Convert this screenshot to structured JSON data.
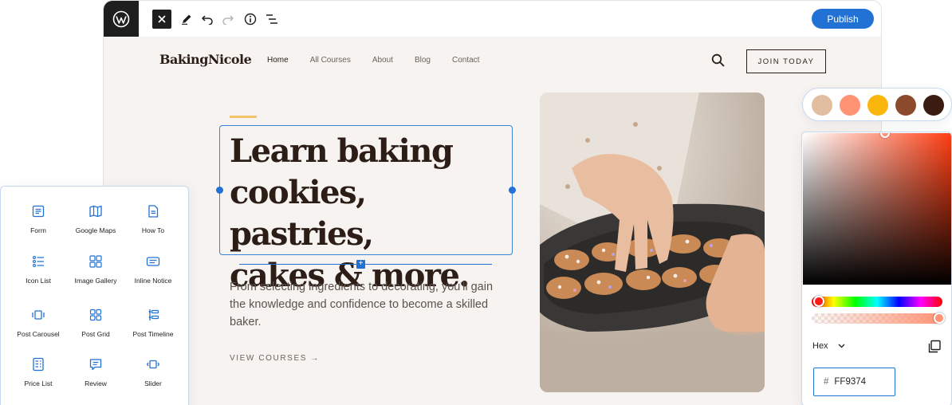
{
  "toolbar": {
    "publish_label": "Publish",
    "icons": [
      "wordpress-logo",
      "close-icon",
      "pencil-icon",
      "undo-icon",
      "redo-icon",
      "info-icon",
      "list-view-icon"
    ]
  },
  "site": {
    "logo": "BakingNicole",
    "nav": [
      "Home",
      "All Courses",
      "About",
      "Blog",
      "Contact"
    ],
    "active_nav": "Home",
    "join_label": "JOIN TODAY"
  },
  "hero": {
    "headline_lines": [
      "Learn baking",
      "cookies, pastries,",
      "cakes & more."
    ],
    "paragraph": "From selecting ingredients to decorating, you'll gain the knowledge and confidence to become a skilled baker.",
    "cta": "VIEW COURSES →"
  },
  "blocks": [
    {
      "label": "Form",
      "icon": "form-icon"
    },
    {
      "label": "Google Maps",
      "icon": "map-icon"
    },
    {
      "label": "How To",
      "icon": "document-icon"
    },
    {
      "label": "Icon List",
      "icon": "icon-list-icon"
    },
    {
      "label": "Image Gallery",
      "icon": "gallery-icon"
    },
    {
      "label": "Inline Notice",
      "icon": "notice-icon"
    },
    {
      "label": "Post Carousel",
      "icon": "carousel-icon"
    },
    {
      "label": "Post Grid",
      "icon": "grid-icon"
    },
    {
      "label": "Post Timeline",
      "icon": "timeline-icon"
    },
    {
      "label": "Price List",
      "icon": "price-list-icon"
    },
    {
      "label": "Review",
      "icon": "review-icon"
    },
    {
      "label": "Slider",
      "icon": "slider-icon"
    }
  ],
  "palette": [
    "#E2BEA0",
    "#FF9374",
    "#FBB60E",
    "#8B4A2B",
    "#3A1C12"
  ],
  "picker": {
    "format": "Hex",
    "hash": "#",
    "hex_value": "FF9374",
    "hue": "#FF3D12"
  },
  "colors": {
    "accent": "#2271D5",
    "text_dark": "#2C1E17",
    "background": "#F7F3F0"
  }
}
